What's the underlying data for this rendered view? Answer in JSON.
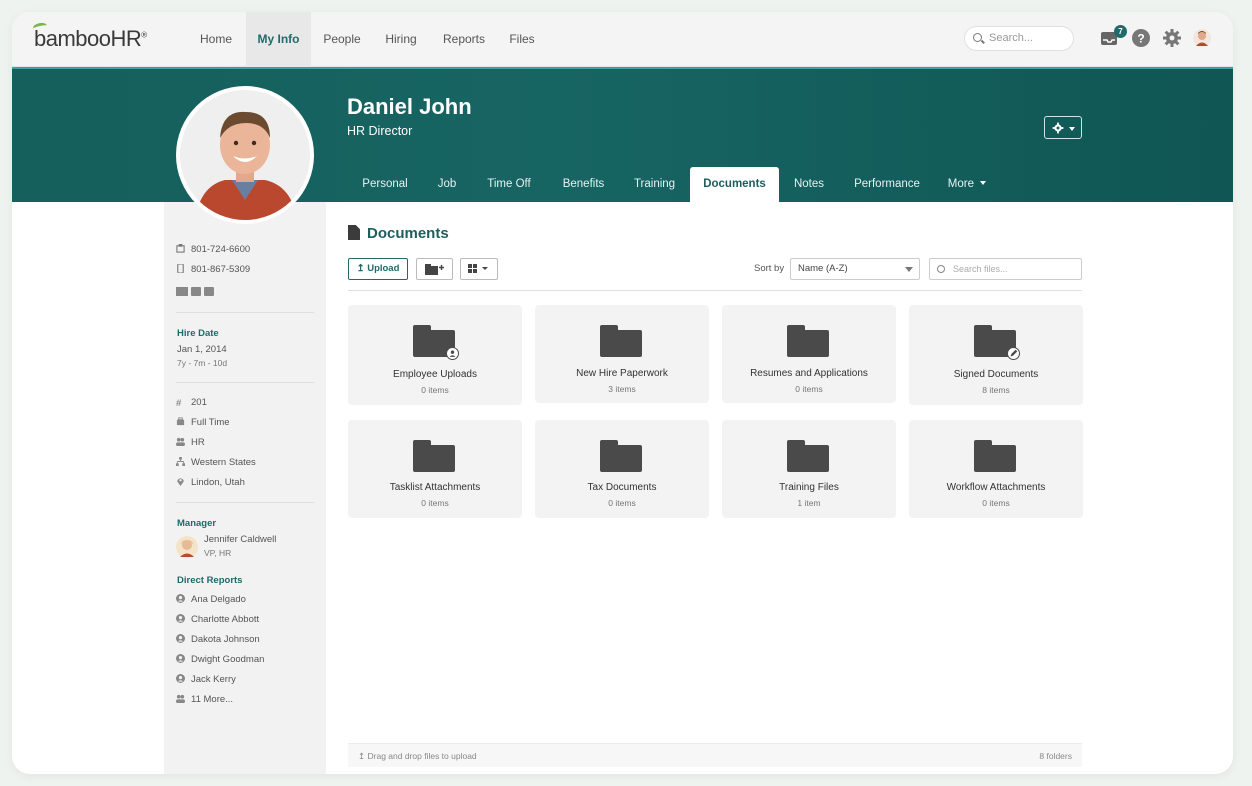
{
  "brand": {
    "logo_text": "bambooHR",
    "logo_mark": "®"
  },
  "nav": {
    "items": [
      "Home",
      "My Info",
      "People",
      "Hiring",
      "Reports",
      "Files"
    ],
    "active": "My Info",
    "search_placeholder": "Search...",
    "notification_count": "7"
  },
  "profile": {
    "name": "Daniel John",
    "title": "HR Director",
    "tabs": [
      "Personal",
      "Job",
      "Time Off",
      "Benefits",
      "Training",
      "Documents",
      "Notes",
      "Performance",
      "More"
    ],
    "active_tab": "Documents"
  },
  "sidebar": {
    "work_phone": "801-724-6600",
    "mobile_phone": "801-867-5309",
    "hire_date_label": "Hire Date",
    "hire_date": "Jan 1, 2014",
    "tenure": "7y - 7m - 10d",
    "employee_number": "201",
    "employment_status": "Full Time",
    "department": "HR",
    "division": "Western States",
    "location": "Lindon, Utah",
    "manager_label": "Manager",
    "manager_name": "Jennifer Caldwell",
    "manager_title": "VP, HR",
    "direct_reports_label": "Direct Reports",
    "direct_reports": [
      "Ana Delgado",
      "Charlotte Abbott",
      "Dakota Johnson",
      "Dwight Goodman",
      "Jack Kerry"
    ],
    "more_reports": "11 More..."
  },
  "documents": {
    "heading": "Documents",
    "upload_label": "Upload",
    "sort_label": "Sort by",
    "sort_value": "Name (A-Z)",
    "search_placeholder": "Search files...",
    "folders": [
      {
        "name": "Employee Uploads",
        "count": "0 items",
        "overlay": "person-icon"
      },
      {
        "name": "New Hire Paperwork",
        "count": "3 items",
        "overlay": ""
      },
      {
        "name": "Resumes and Applications",
        "count": "0 items",
        "overlay": ""
      },
      {
        "name": "Signed Documents",
        "count": "8 items",
        "overlay": "pen-icon"
      },
      {
        "name": "Tasklist Attachments",
        "count": "0 items",
        "overlay": ""
      },
      {
        "name": "Tax Documents",
        "count": "0 items",
        "overlay": ""
      },
      {
        "name": "Training Files",
        "count": "1 item",
        "overlay": ""
      },
      {
        "name": "Workflow Attachments",
        "count": "0 items",
        "overlay": ""
      }
    ],
    "footer_hint": "Drag and drop files to upload",
    "folder_total": "8 folders"
  },
  "colors": {
    "brand_teal": "#1e6b69",
    "band": "#176563",
    "logo_green": "#7ab648"
  }
}
